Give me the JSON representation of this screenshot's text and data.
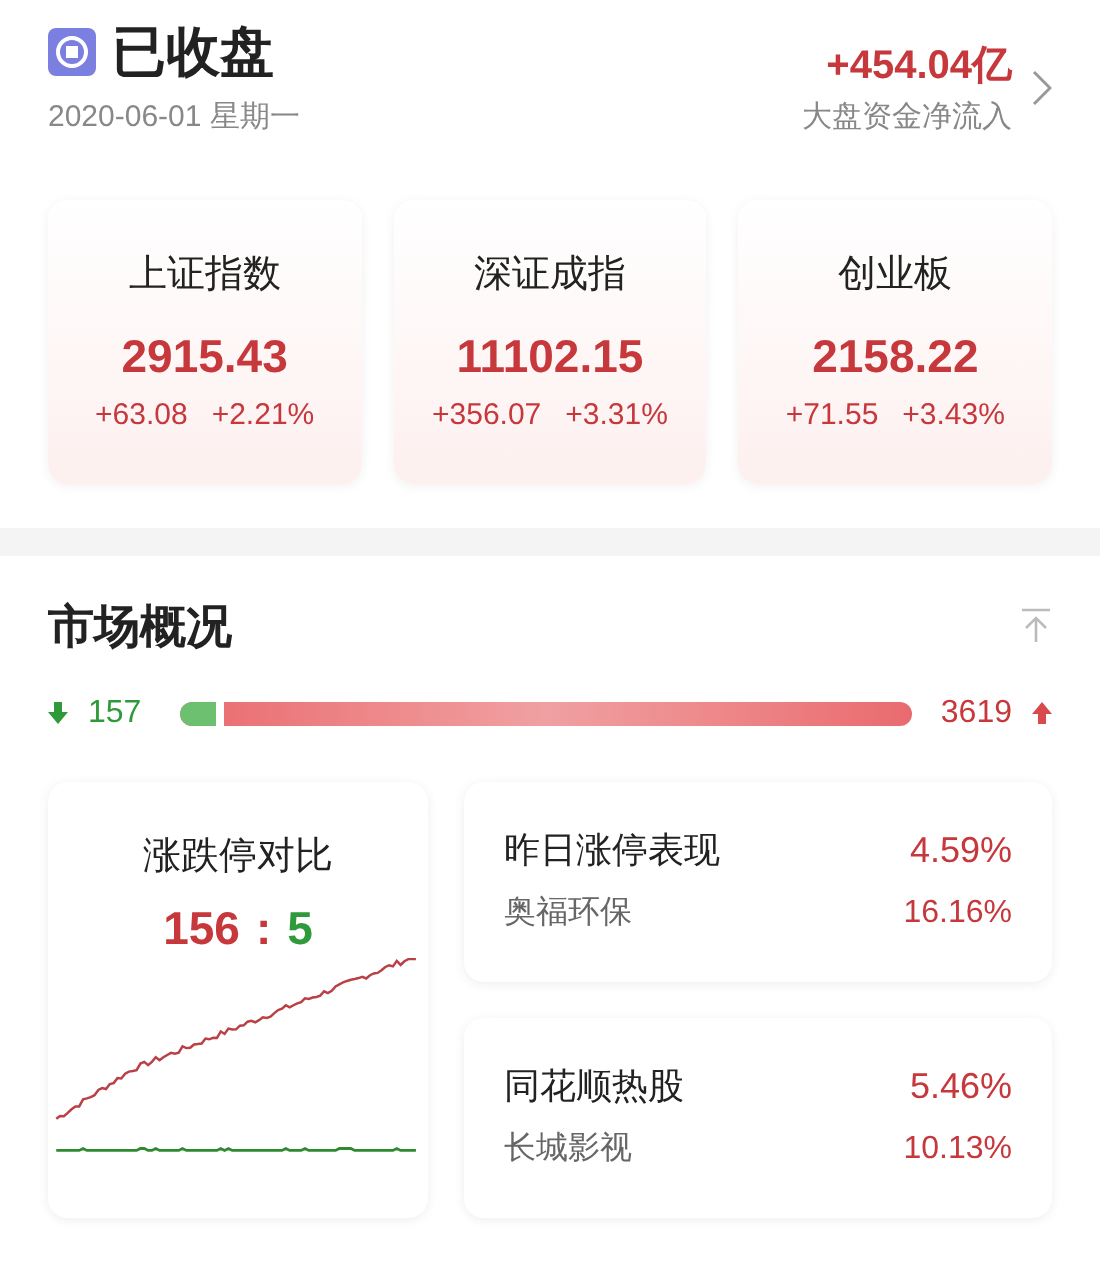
{
  "header": {
    "title": "已收盘",
    "date": "2020-06-01 星期一",
    "net_inflow": "+454.04亿",
    "net_inflow_label": "大盘资金净流入"
  },
  "indices": [
    {
      "name": "上证指数",
      "value": "2915.43",
      "change": "+63.08",
      "percent": "+2.21%"
    },
    {
      "name": "深证成指",
      "value": "11102.15",
      "change": "+356.07",
      "percent": "+3.31%"
    },
    {
      "name": "创业板",
      "value": "2158.22",
      "change": "+71.55",
      "percent": "+3.43%"
    }
  ],
  "market": {
    "title": "市场概况",
    "down_count": "157",
    "up_count": "3619",
    "ratio": {
      "level": 0.06
    },
    "limit_card": {
      "title": "涨跌停对比",
      "up": "156",
      "separator": ":",
      "down": "5"
    },
    "panels": [
      {
        "title": "昨日涨停表现",
        "title_value": "4.59%",
        "stock": "奥福环保",
        "stock_value": "16.16%"
      },
      {
        "title": "同花顺热股",
        "title_value": "5.46%",
        "stock": "长城影视",
        "stock_value": "10.13%"
      }
    ]
  }
}
